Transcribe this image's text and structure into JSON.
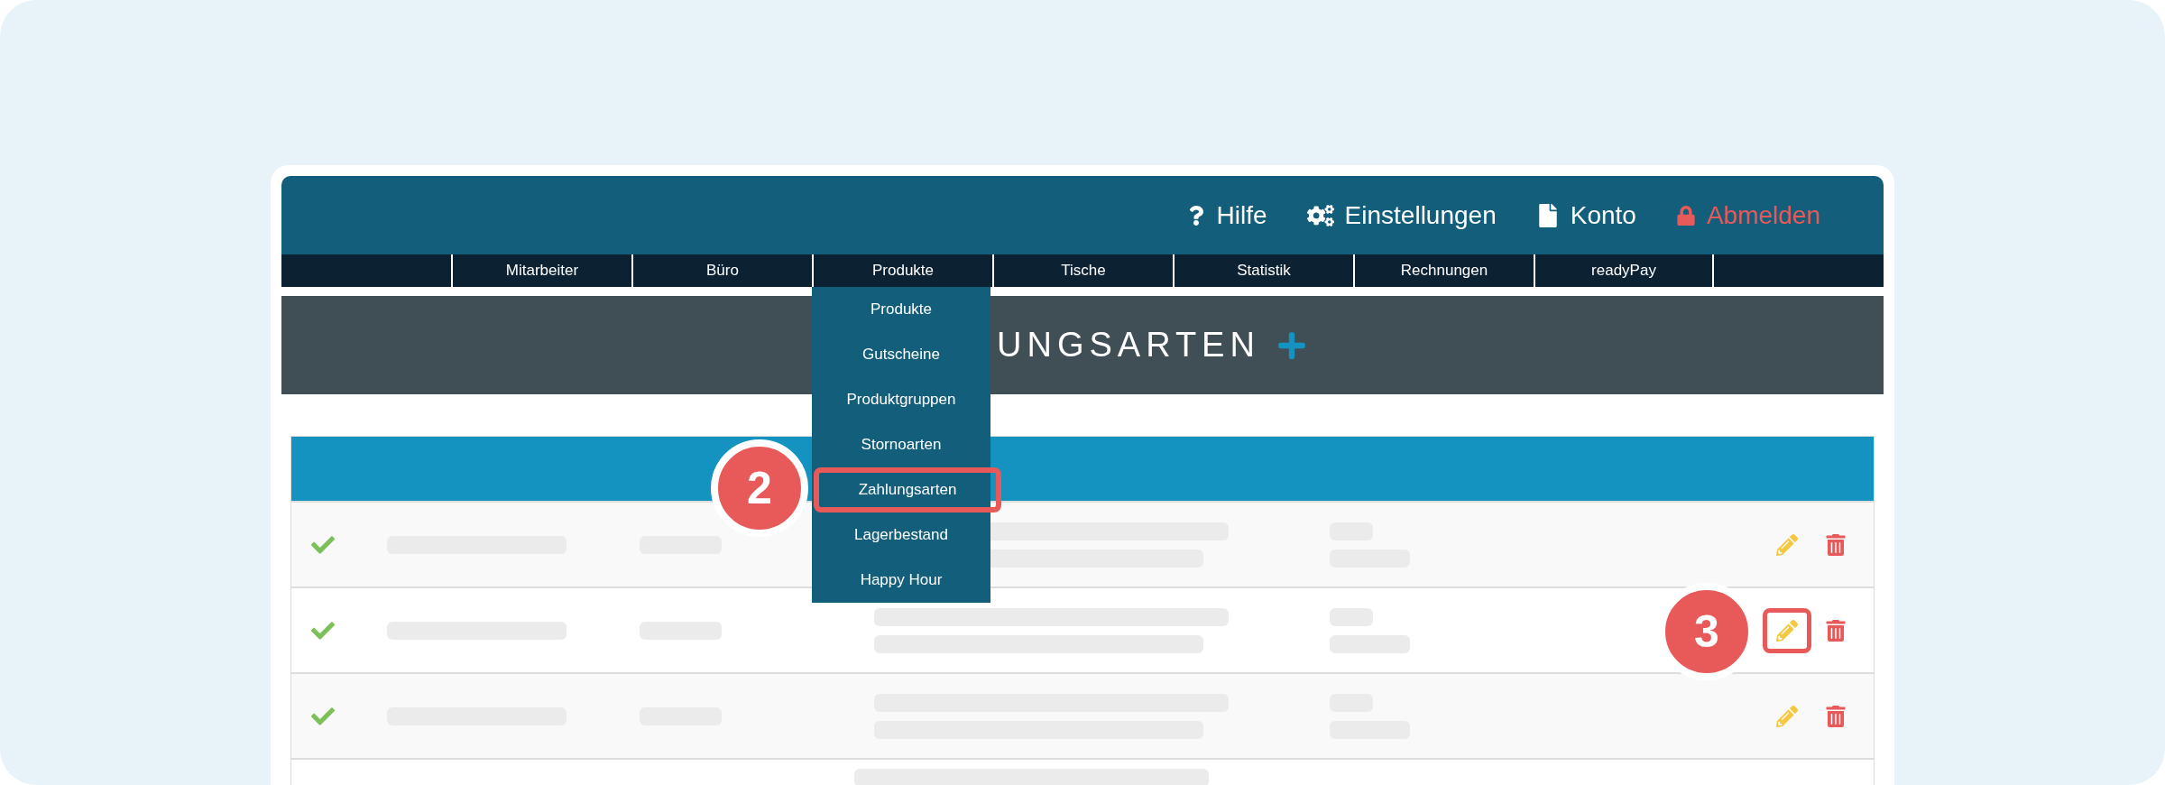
{
  "header_links": [
    {
      "label": "Hilfe",
      "kind": "help"
    },
    {
      "label": "Einstellungen",
      "kind": "settings"
    },
    {
      "label": "Konto",
      "kind": "account"
    },
    {
      "label": "Abmelden",
      "kind": "logout"
    }
  ],
  "nav": [
    {
      "label": "Mitarbeiter"
    },
    {
      "label": "Büro"
    },
    {
      "label": "Produkte"
    },
    {
      "label": "Tische"
    },
    {
      "label": "Statistik"
    },
    {
      "label": "Rechnungen"
    },
    {
      "label": "readyPay"
    }
  ],
  "dropdown": [
    {
      "label": "Produkte",
      "highlighted": false
    },
    {
      "label": "Gutscheine",
      "highlighted": false
    },
    {
      "label": "Produktgruppen",
      "highlighted": false
    },
    {
      "label": "Stornoarten",
      "highlighted": false
    },
    {
      "label": "Zahlungsarten",
      "highlighted": true
    },
    {
      "label": "Lagerbestand",
      "highlighted": false
    },
    {
      "label": "Happy Hour",
      "highlighted": false
    }
  ],
  "page_title": "UNGSARTEN",
  "rows": [
    {
      "active": true,
      "edit_highlighted": false
    },
    {
      "active": true,
      "edit_highlighted": true
    },
    {
      "active": true,
      "edit_highlighted": false
    }
  ],
  "annotations": [
    {
      "label": "2"
    },
    {
      "label": "3"
    }
  ]
}
